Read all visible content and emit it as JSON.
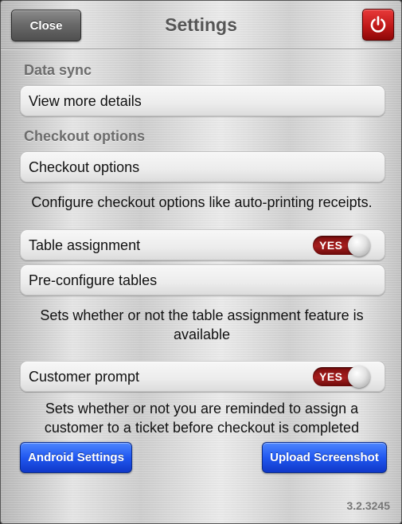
{
  "header": {
    "close_label": "Close",
    "title": "Settings",
    "power_icon": "power-icon"
  },
  "data_sync": {
    "section_label": "Data sync",
    "view_details_label": "View more details"
  },
  "checkout": {
    "section_label": "Checkout options",
    "row_label": "Checkout options",
    "description": "Configure checkout options like auto-printing receipts."
  },
  "table_assignment": {
    "row_label": "Table assignment",
    "toggle_label": "YES",
    "preconfigure_label": "Pre-configure tables",
    "description_line1": "Sets whether or not the table assignment feature is",
    "description_line2": "available"
  },
  "customer_prompt": {
    "row_label": "Customer prompt",
    "toggle_label": "YES",
    "description_line1": "Sets whether or not you are reminded to assign a",
    "description_line2": "customer to a ticket before checkout is completed"
  },
  "footer": {
    "android_settings_label": "Android Settings",
    "upload_screenshot_label": "Upload Screenshot",
    "version": "3.2.3245"
  },
  "colors": {
    "power_button": "#c01818",
    "toggle_on": "#a71e1e",
    "primary_button": "#2158f0"
  }
}
